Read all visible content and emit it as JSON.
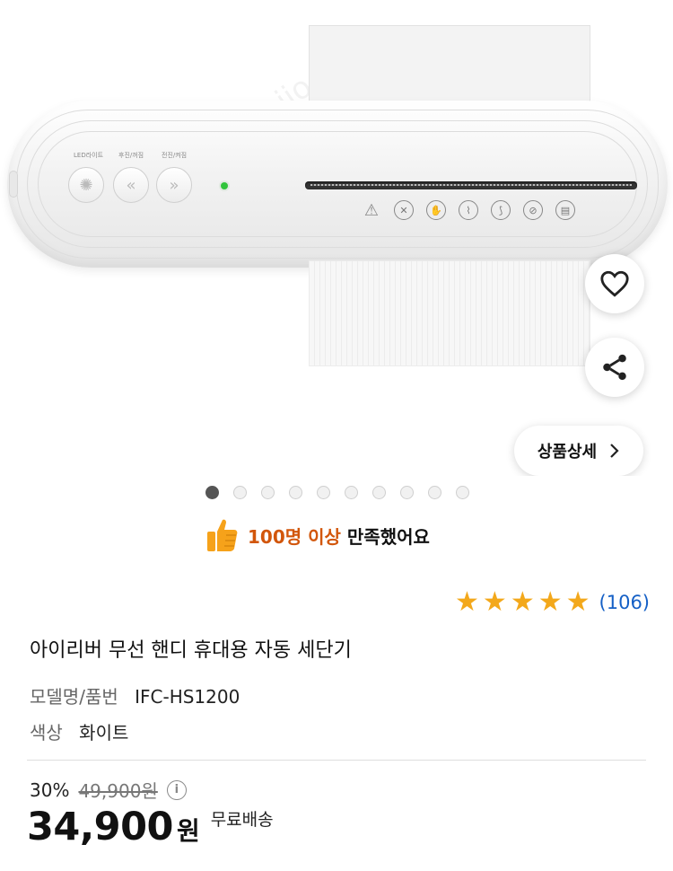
{
  "hero": {
    "control_labels": [
      "LED라이트",
      "후진/꺼짐",
      "전진/켜짐"
    ],
    "icons": [
      "light-icon",
      "reverse-icon",
      "forward-icon"
    ]
  },
  "actions": {
    "favorite_icon": "heart-icon",
    "share_icon": "share-icon",
    "detail_label": "상품상세",
    "detail_icon": "chevron-right-icon"
  },
  "carousel": {
    "total": 10,
    "active_index": 0
  },
  "satisfaction": {
    "highlight": "100명 이상",
    "text": "만족했어요",
    "icon": "thumbs-up-icon"
  },
  "rating": {
    "stars": 5,
    "count_text": "(106)",
    "star_color": "#f3a81b"
  },
  "product": {
    "title": "아이리버 무선 핸디 휴대용 자동 세단기",
    "model_label": "모델명/품번",
    "model_value": "IFC-HS1200",
    "color_label": "색상",
    "color_value": "화이트"
  },
  "price": {
    "discount": "30%",
    "original": "49,900원",
    "current": "34,900",
    "currency": "원",
    "shipping": "무료배송"
  },
  "colors": {
    "accent_orange": "#d2560b",
    "link_blue": "#1560c6"
  }
}
